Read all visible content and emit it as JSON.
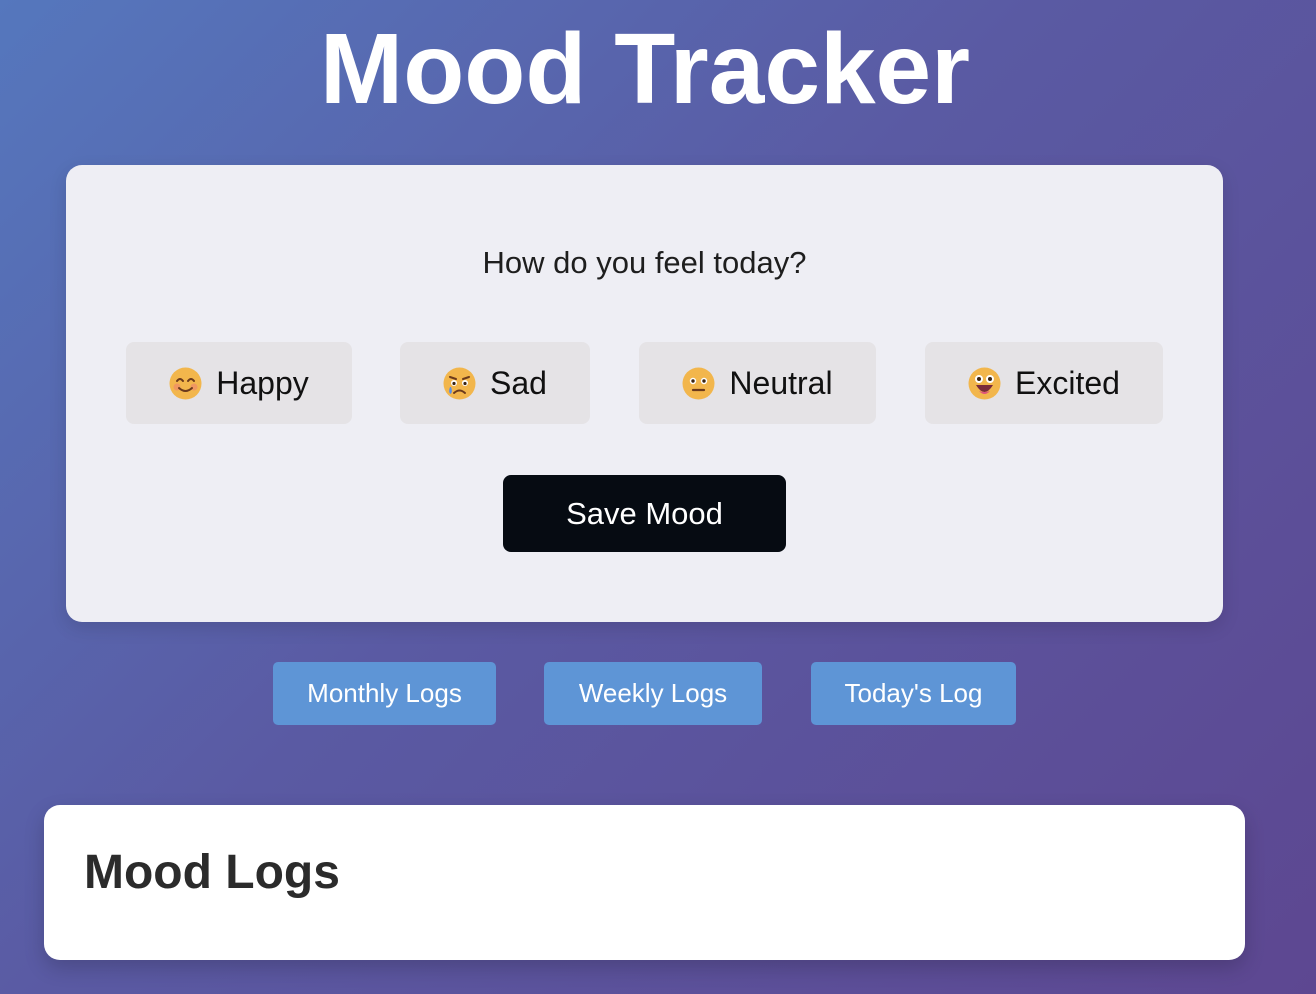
{
  "app": {
    "title": "Mood Tracker"
  },
  "mood_card": {
    "question": "How do you feel today?",
    "options": [
      {
        "label": "Happy",
        "icon": "smiling-face-icon"
      },
      {
        "label": "Sad",
        "icon": "crying-face-icon"
      },
      {
        "label": "Neutral",
        "icon": "neutral-face-icon"
      },
      {
        "label": "Excited",
        "icon": "grinning-face-icon"
      }
    ],
    "save_label": "Save Mood"
  },
  "log_tabs": [
    {
      "label": "Monthly Logs"
    },
    {
      "label": "Weekly Logs"
    },
    {
      "label": "Today's Log"
    }
  ],
  "logs_panel": {
    "heading": "Mood Logs"
  },
  "colors": {
    "background_start": "#5577bd",
    "background_end": "#5d4791",
    "card": "#eeeef4",
    "option": "#e5e3e6",
    "save_button": "#060b12",
    "tab": "#5e95d6",
    "emoji_face": "#f2b64c"
  }
}
